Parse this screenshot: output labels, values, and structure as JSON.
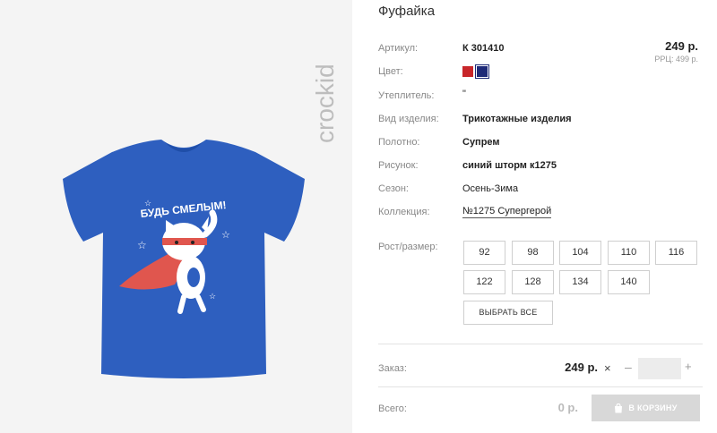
{
  "brand": {
    "name": "crockid"
  },
  "product": {
    "title": "Фуфайка",
    "price": "249 р.",
    "rrp": "РРЦ: 499 р.",
    "print_text": "БУДЬ СМЕЛЫМ!"
  },
  "attributes": {
    "article": {
      "label": "Артикул:",
      "value": "К 301410"
    },
    "color": {
      "label": "Цвет:",
      "swatches": [
        "#c8262a",
        "#1e2a78"
      ]
    },
    "insulation": {
      "label": "Утеплитель:",
      "value": "\""
    },
    "item_type": {
      "label": "Вид изделия:",
      "value": "Трикотажные изделия"
    },
    "fabric": {
      "label": "Полотно:",
      "value": "Супрем"
    },
    "pattern": {
      "label": "Рисунок:",
      "value": "синий шторм к1275"
    },
    "season": {
      "label": "Сезон:",
      "value": "Осень-Зима"
    },
    "collection": {
      "label": "Коллекция:",
      "value": "№1275 Супергерой"
    }
  },
  "sizes": {
    "label": "Рост/размер:",
    "options": [
      "92",
      "98",
      "104",
      "110",
      "116",
      "122",
      "128",
      "134",
      "140"
    ],
    "select_all": "ВЫБРАТЬ ВСЕ"
  },
  "order": {
    "label": "Заказ:",
    "price": "249 р.",
    "quantity": "",
    "minus": "–",
    "plus": "+"
  },
  "total": {
    "label": "Всего:",
    "value": "0 р.",
    "cart_button": "В КОРЗИНУ"
  }
}
